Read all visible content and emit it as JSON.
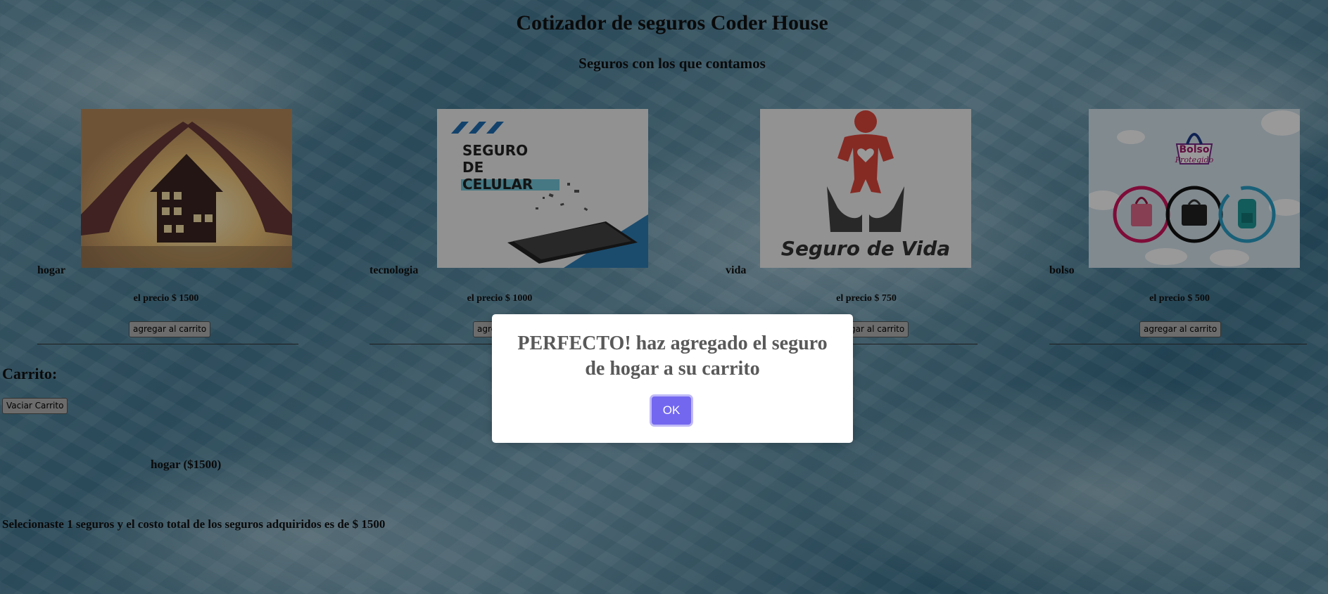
{
  "header": {
    "title": "Cotizador de seguros Coder House",
    "subtitle": "Seguros con los que contamos"
  },
  "products": [
    {
      "name": "hogar",
      "price": "el precio $ 1500",
      "button": "agregar al carrito",
      "image_icon": "house-hands-icon"
    },
    {
      "name": "tecnologia",
      "price": "el precio $ 1000",
      "button": "agregar al carrito",
      "image_icon": "phone-insurance-icon",
      "image_text": [
        "SEGURO",
        "DE",
        "CELULAR"
      ]
    },
    {
      "name": "vida",
      "price": "el precio $ 750",
      "button": "agregar al carrito",
      "image_icon": "life-insurance-icon",
      "image_text": "Seguro de Vida"
    },
    {
      "name": "bolso",
      "price": "el precio $ 500",
      "button": "agregar al carrito",
      "image_icon": "bag-insurance-icon",
      "image_text": [
        "Bolso",
        "Protegido"
      ]
    }
  ],
  "cart": {
    "heading": "Carrito:",
    "empty_button": "Vaciar Carrito",
    "items": [
      "hogar ($1500)"
    ],
    "summary": "Selecionaste 1 seguros y el costo total de los seguros adquiridos es de $ 1500"
  },
  "dialog": {
    "message": "PERFECTO! haz agregado el seguro de hogar a su carrito",
    "ok_label": "OK"
  },
  "colors": {
    "confirm_button": "#7367f0",
    "overlay": "rgba(0,0,0,0.4)"
  }
}
